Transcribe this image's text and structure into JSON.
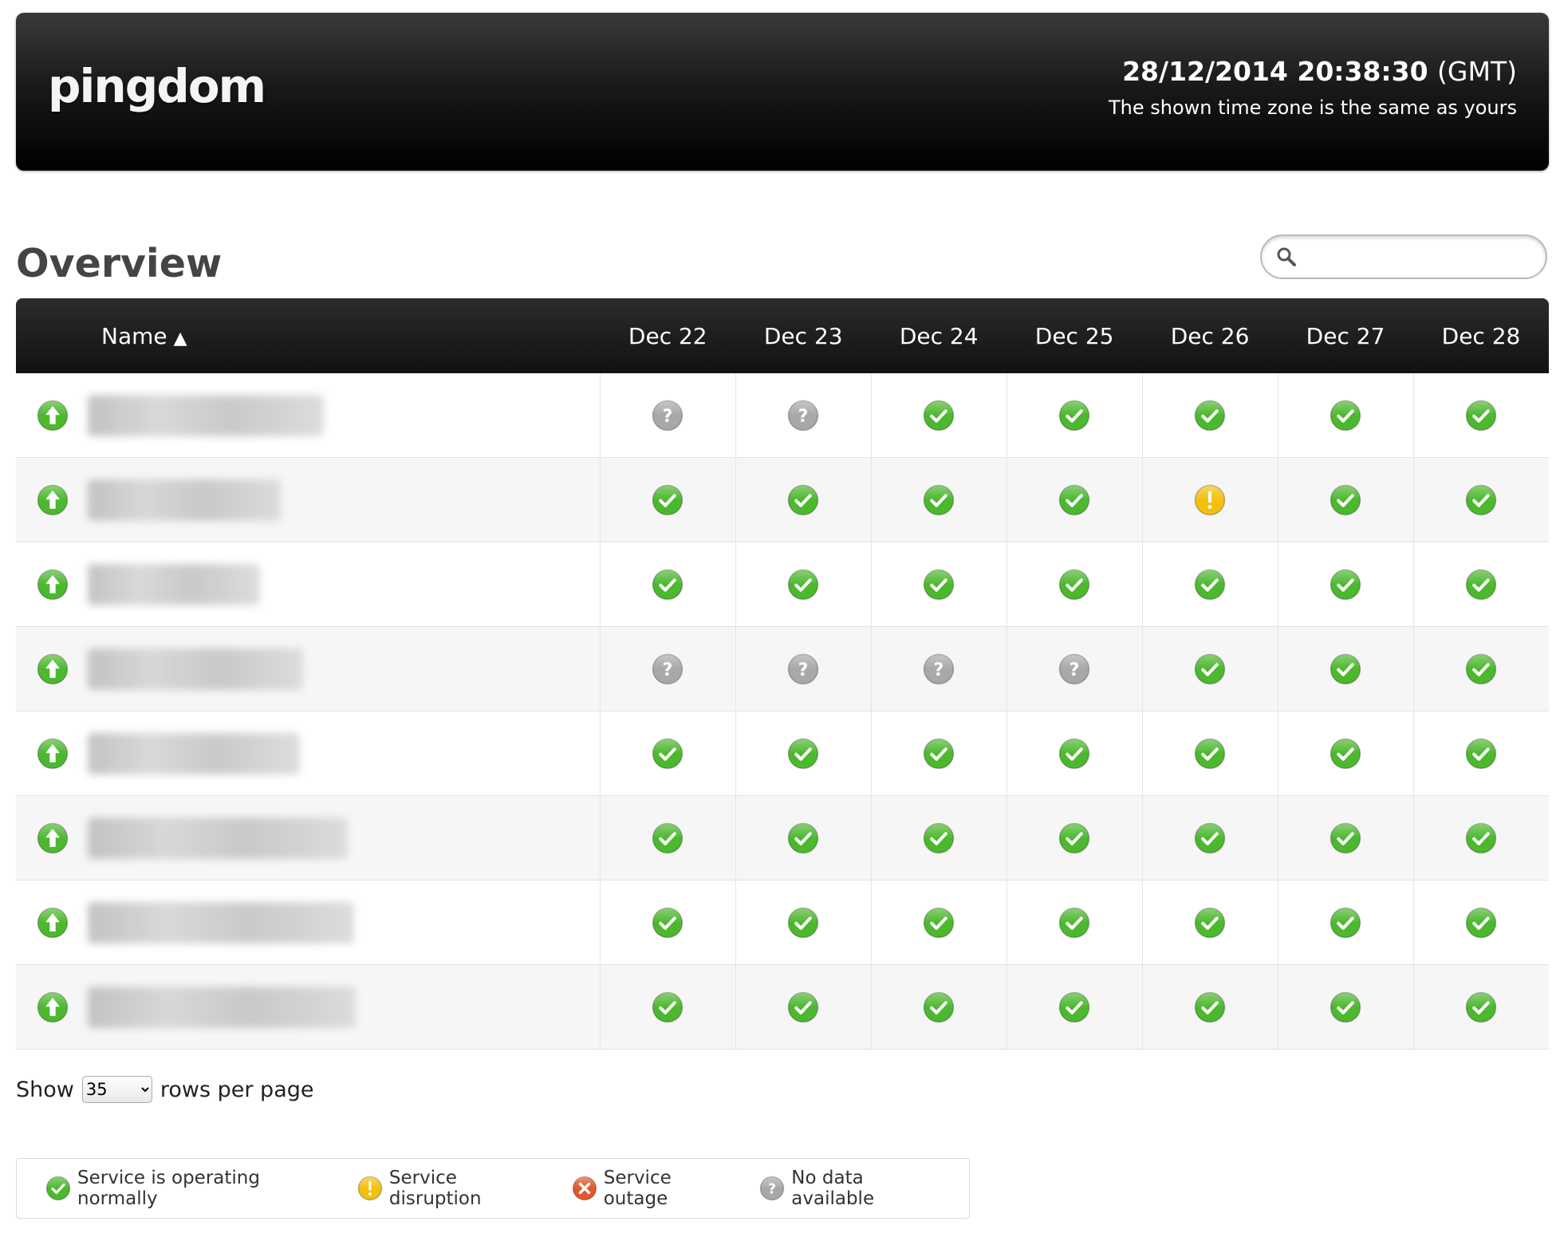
{
  "header": {
    "logo": "pingdom",
    "datetime": "28/12/2014 20:38:30",
    "timezone": "(GMT)",
    "tz_note": "The shown time zone is the same as yours"
  },
  "overview": {
    "title": "Overview",
    "search": {
      "placeholder": "",
      "value": ""
    }
  },
  "table": {
    "name_header": "Name",
    "sort_indicator": "▲",
    "days": [
      "Dec 22",
      "Dec 23",
      "Dec 24",
      "Dec 25",
      "Dec 26",
      "Dec 27",
      "Dec 28"
    ],
    "rows": [
      {
        "status": "up",
        "name": "",
        "days": [
          "nodata",
          "nodata",
          "ok",
          "ok",
          "ok",
          "ok",
          "ok"
        ]
      },
      {
        "status": "up",
        "name": "",
        "days": [
          "ok",
          "ok",
          "ok",
          "ok",
          "disruption",
          "ok",
          "ok"
        ]
      },
      {
        "status": "up",
        "name": "",
        "days": [
          "ok",
          "ok",
          "ok",
          "ok",
          "ok",
          "ok",
          "ok"
        ]
      },
      {
        "status": "up",
        "name": "",
        "days": [
          "nodata",
          "nodata",
          "nodata",
          "nodata",
          "ok",
          "ok",
          "ok"
        ]
      },
      {
        "status": "up",
        "name": "",
        "days": [
          "ok",
          "ok",
          "ok",
          "ok",
          "ok",
          "ok",
          "ok"
        ]
      },
      {
        "status": "up",
        "name": "",
        "days": [
          "ok",
          "ok",
          "ok",
          "ok",
          "ok",
          "ok",
          "ok"
        ]
      },
      {
        "status": "up",
        "name": "",
        "days": [
          "ok",
          "ok",
          "ok",
          "ok",
          "ok",
          "ok",
          "ok"
        ]
      },
      {
        "status": "up",
        "name": "",
        "days": [
          "ok",
          "ok",
          "ok",
          "ok",
          "ok",
          "ok",
          "ok"
        ]
      }
    ]
  },
  "pagination": {
    "show_label": "Show",
    "rows_per_page": "35",
    "suffix": "rows per page"
  },
  "legend": [
    {
      "icon": "ok",
      "label": "Service is operating normally"
    },
    {
      "icon": "disruption",
      "label": "Service disruption"
    },
    {
      "icon": "outage",
      "label": "Service outage"
    },
    {
      "icon": "nodata",
      "label": "No data available"
    }
  ],
  "colors": {
    "ok": "#4cb82e",
    "disruption": "#f3c010",
    "outage": "#e2572c",
    "nodata": "#a8a8a8",
    "header_bg": "#1a1a1a"
  }
}
